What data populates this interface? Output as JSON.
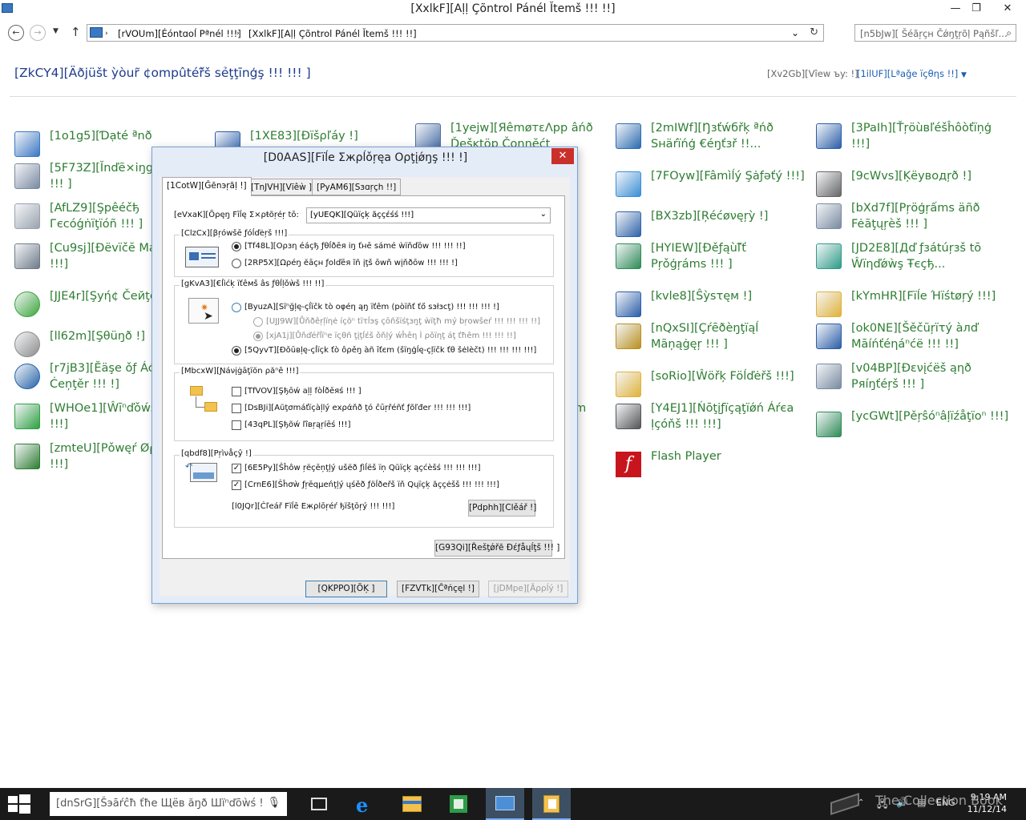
{
  "window": {
    "title": "[XxlkF][Aḷḷ Çõntrol Pánél Ĭtemš !!! !!]",
    "min": "—",
    "max": "❐",
    "close": "✕"
  },
  "address": {
    "crumb1": "[rVOUm][Éóntɑoĺ Pªnél !!!]",
    "crumb2": "[XxlkF][Aḷḷ Çõntrol Pánél Ĭtemš !!! !!]",
    "search_placeholder": "[n5bJw][ Šéãŗçн Čǿŋţŗõḷ Pąñšľ..."
  },
  "header": {
    "adjust": "[ZkCY4][Äðjüšt ỳòur̃ ¢ompûtéř̃š sẻţţīnģş !!! !!! ]",
    "viewby": "[Xv2Gb][Vîew ъy: !]",
    "viewval": "[1ilUF][Lªaǧe ïçθηs !!]"
  },
  "items": [
    {
      "label": "[1o1g5][Ɗạté ªnð Ţimê !!!]",
      "icon": "calendar-icon"
    },
    {
      "label": "[5F73Z][Ĭnďẽ×iŋg",
      "label2": "!!! ]",
      "icon": "indexing-icon"
    },
    {
      "label": "[AfLZ9][Şpêéčђ",
      "label2": "Гєcóǵṅïţïóñ !!! ]",
      "icon": "microphone-icon"
    },
    {
      "label": "[Cu9sj][Ðëvïčĕ Má",
      "label2": "!!!]",
      "icon": "device-manager-icon"
    },
    {
      "label": "[JJE4r][Şуή¢ Čeйţе",
      "icon": "sync-center-icon"
    },
    {
      "label": "[ll62m][Şθüŋð !]",
      "icon": "speaker-icon"
    },
    {
      "label": "[r7jB3][Ĕäşe ǒƒ Áć",
      "label2": "Ċeņţěr !!! !]",
      "icon": "ease-of-access-icon"
    },
    {
      "label": "[WHOe1][Ŵīⁿďǒẃs",
      "label2": "!!!]",
      "icon": "windows-update-icon"
    },
    {
      "label": "[zmteU][Ρǒwęŕ Øρ",
      "label2": "!!!]",
      "icon": "battery-icon"
    },
    {
      "label": "[1XE83][Đïšρľáy !]",
      "icon": "display-icon"
    },
    {
      "label": "[1yejw][ЯêmøтεΛpp âńð",
      "label2": "Ďęšĸtöp Čǫnŋĕćt",
      "icon": "remote-app-icon"
    },
    {
      "label": "đєm",
      "icon": "none"
    },
    {
      "label": "[2mIWf][Ŋзťẃбřķ ªńð",
      "label2": "Sнäŕïńģ €éŋťзř !!...",
      "icon": "network-icon"
    },
    {
      "label": "[7FOyw][Fâmìĺý Şȧƒəťý !!!]",
      "icon": "family-safety-icon"
    },
    {
      "label": "[BX3zb][Ŗéćøνęŗỳ !]",
      "icon": "recovery-icon"
    },
    {
      "label": "[HYIEW][Ðěƒąùľ̃ť",
      "label2": "Ρŗǒģŗáms !!! ]",
      "icon": "default-programs-icon"
    },
    {
      "label": "[kvle8][Ŝỳsτęм !]",
      "icon": "system-icon"
    },
    {
      "label": "[nQxSI][Çŕēðèŋţïąĺ",
      "label2": "Mãņąġęŗ !!! ]",
      "icon": "credential-manager-icon"
    },
    {
      "label": "[soRio][Ŵöřķ Föĺďėřš !!!]",
      "icon": "work-folders-icon"
    },
    {
      "label": "[Y4EJ1][Ńōţįƒïçąţïǿń Áŕєа",
      "label2": "Ịçóňš !!! !!!]",
      "icon": "notification-area-icon"
    },
    {
      "label": "Flash Player",
      "icon": "flash-player-icon"
    },
    {
      "label": "[3PaIh][Ťŗöùвľéšĥôòťïņģ",
      "label2": "!!!]",
      "icon": "troubleshooting-icon"
    },
    {
      "label": "[9cWvs][Ķёуводŗð !]",
      "icon": "keyboard-icon"
    },
    {
      "label": "[bXd7f][Ρŗöģŗấms äñð",
      "label2": "Fėãţųŗèš !!! ]",
      "icon": "programs-features-icon"
    },
    {
      "label": "[JD2E8][Дď ƒзátúŗзš tō",
      "label2": "Ŵïηďǿẁş Ŧєçђ...",
      "icon": "add-features-icon"
    },
    {
      "label": "[kYmHR][Fïĺe Ήïśtøŗý !!!]",
      "icon": "file-history-icon"
    },
    {
      "label": "[ok0NE][Šěčũŗïτý àлď",
      "label2": "Μāíńťéηáⁿćë !!! !!]",
      "icon": "security-flag-icon"
    },
    {
      "label": "[v04BP][Ðενįćëš ąηð",
      "label2": "Ρяíŋťéŗš !!! ]",
      "icon": "printer-icon"
    },
    {
      "label": "[ycGWt][Ρěŗŝóⁿâļïźåţïoⁿ !!!]",
      "icon": "personalization-icon"
    }
  ],
  "dialog": {
    "title": "[D0AAS][Fïĺe Ʃжρĺǒŗęa Oρţįǿŋş !!! !]",
    "tabs": [
      "[1CotW][Ĝēnэŗãḷ !]",
      "[TnJVH][Vïêẁ ]",
      "[PyAM6][Sɜɑŗçh !!]"
    ],
    "open_label": "[eVxaK][Õρęŋ Fīĺę Ʃ×ρŧõŗéŗ tō:",
    "open_value": "[yUEQK][Qüïçķ ãççέśś !!!]",
    "browse_title": "[ClzCx][βŗówšē ƒóĺďėŗš !!!]",
    "browse_opt1": "[Tf48L][Oρзη éáçђ ƒθĺðēя iŋ ťнē sámé ẁïňďōw !!! !!! !!]",
    "browse_opt2": "[2RP5X][Ωρéŋ ĕāçн ƒolďēя ĩñ įţš ōwň wįňðōw !!! !!! !]",
    "click_title": "[gKvA3][€ĺìćķ ïťêмš âs ƒθĺļǒẁš !!! !!]",
    "click_opt1": "[ByuzA][Sïⁿğļę-çĺïčk tò oφéη ąŋ ïťêm (pòïňť ťő sзłзcţ) !!! !!! !!! !]",
    "click_sub1": "[UJJ9W][Ůňðêŗļïηė íçŏⁿ tïτĺэş çōñšïśţзŋţ ẁïţħ mý bŗowšеŕ !!! !!! !!! !!]",
    "click_sub2": "[xjA1j][Ůňďéřĺïⁿe ïςθñ ţįţĺέš ǒňļý ẃĥêη Ì ρǒïηţ áţ ťħêm !!! !!! !!]",
    "click_opt2": "[5QyvT][Ðǒūвļę-çĺïçk ťò ôρěŋ àñ īťєm (šïŋģĺę-çļïčk ťθ šėlèčt) !!! !!! !!! !!!]",
    "nav_title": "[MbcxW][Ɲáνįġāţïŏn ρăⁿê !!!]",
    "nav_opt1": "[TfVOV][Şђōẃ aļļ fòĺðēяś !!! ]",
    "nav_opt2": "[DsBJi][Aŭţσmáťïçàļlý ехράňð ţó ĉūŗřéñť ƒõľđer !!! !!! !!!]",
    "nav_opt3": "[43qPL][Şђõẃ ľîвŗąŗíēś !!!]",
    "privacy_title": "[qbdf8][Ρŗìνåçŷ !]",
    "privacy_opt1": "[6E5Py][Ŝĥôw ŗёçēņţļý ušёð ƒìĺёš ïņ Qŭïçķ ąçćèšś !!! !!! !!!]",
    "privacy_opt2": "[CrnE6][Ŝĥσẁ ƒŗēqµеńţļý ųśěð ƒöĺðеřš ïň Qųïçķ ăççėšš !!! !!! !!!]",
    "clear_label": "[l0JQr][Ċľеář Fïĺē Ежρlōŗéŕ ђïšţōŗý !!! !!!]",
    "clear_btn": "[Pdphh][Clěář !]",
    "restore_btn": "[G93Qi][Řеšţǿřē Ðέƒåųĺţš !!! ]",
    "ok_btn": "[QKPPO][ÕĶ ]",
    "cancel_btn": "[FZVTk][Ĉªńçęl !]",
    "apply_btn": "[jDMpe][Āρρĺý !]"
  },
  "taskbar": {
    "search": "[dnSrG][Šэāŕĉħ ťħе Щёв ăŋð Шїⁿďōẁś ! ",
    "lang": "ENG",
    "time": "9:19 AM",
    "date": "11/12/14",
    "watermark": "The Collection Book"
  }
}
